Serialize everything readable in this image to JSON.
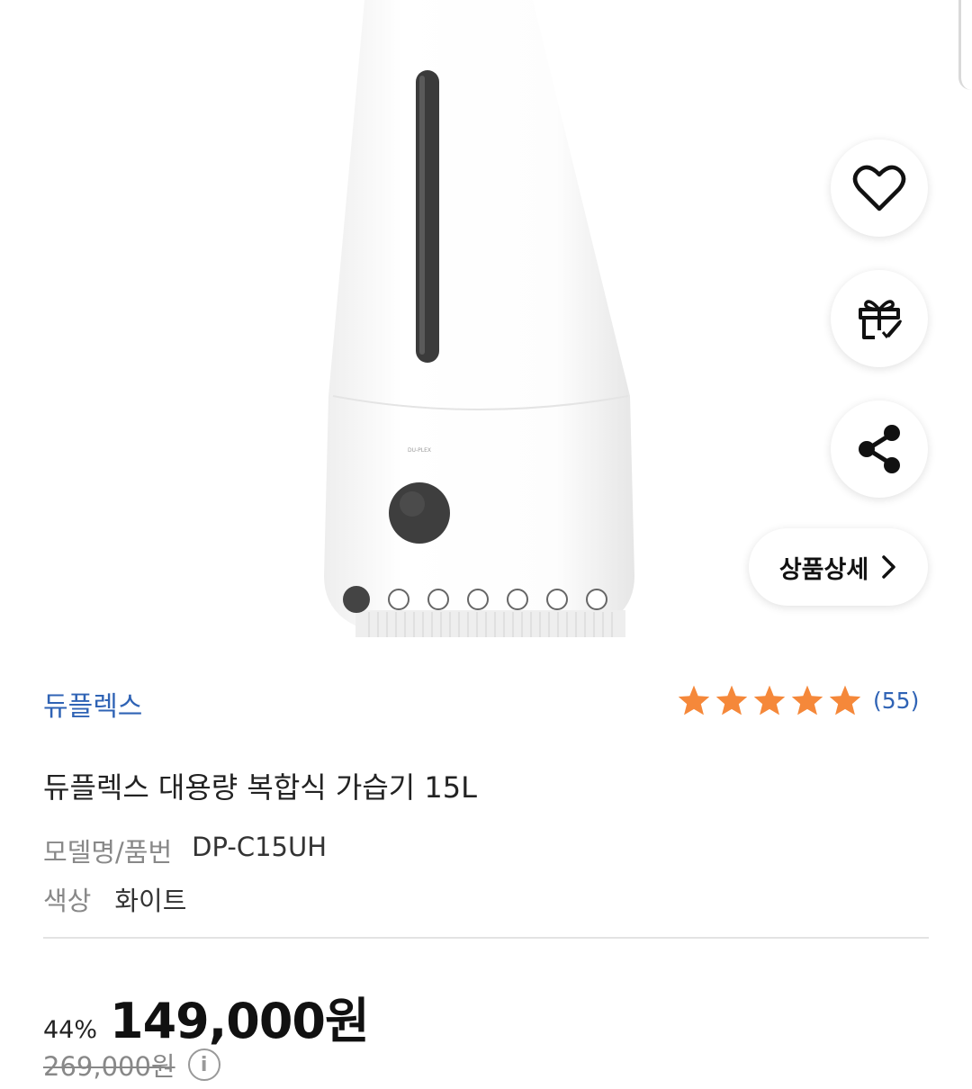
{
  "product_image": {
    "brand_mark": "DU-PLEX"
  },
  "actions": {
    "wishlist_icon": "heart-icon",
    "gift_icon": "gift-icon",
    "share_icon": "share-icon",
    "detail_label": "상품상세"
  },
  "carousel": {
    "total": 7,
    "active_index": 0
  },
  "product": {
    "brand": "듀플렉스",
    "rating": 5,
    "review_count": "(55)",
    "title": "듀플렉스 대용량 복합식 가습기 15L",
    "model_label": "모델명/품번",
    "model_value": "DP-C15UH",
    "color_label": "색상",
    "color_value": "화이트"
  },
  "price": {
    "discount": "44%",
    "sale": "149,000원",
    "original": "269,000원"
  },
  "colors": {
    "brand_link": "#2f63b5",
    "star": "#f5883a"
  }
}
